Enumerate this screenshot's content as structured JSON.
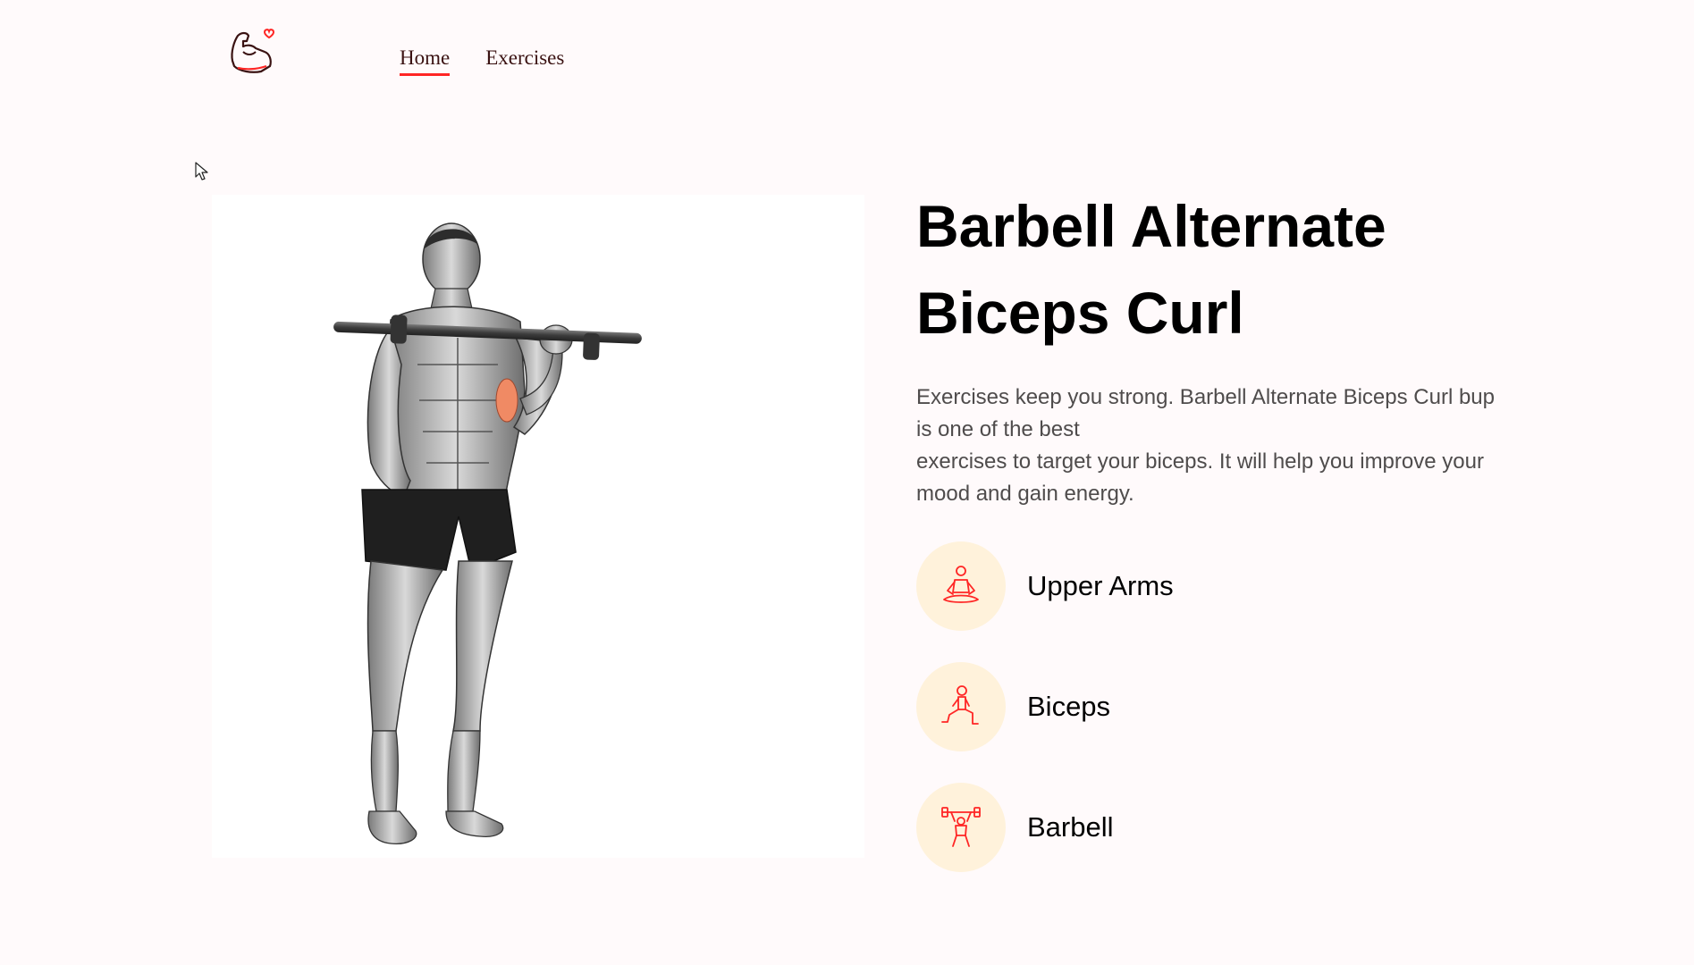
{
  "nav": {
    "logo_icon": "flexed-arm-heart-logo",
    "items": [
      {
        "label": "Home",
        "active": true
      },
      {
        "label": "Exercises",
        "active": false
      }
    ]
  },
  "exercise": {
    "image_subject": "barbell-alternate-biceps-curl-figure",
    "title": "Barbell Alternate Biceps Curl",
    "description_lines": [
      "Exercises keep you strong. Barbell Alternate Biceps Curl bup is one of the best",
      "exercises to target your biceps. It will help you improve your mood and gain energy."
    ],
    "details": [
      {
        "label": "Upper Arms",
        "icon": "meditation-pose-icon"
      },
      {
        "label": "Biceps",
        "icon": "lunge-pose-icon"
      },
      {
        "label": "Barbell",
        "icon": "weightlifter-icon"
      }
    ]
  },
  "colors": {
    "accent": "#ff2625",
    "icon_bg": "#fff2db",
    "page_bg": "#fffafb"
  }
}
